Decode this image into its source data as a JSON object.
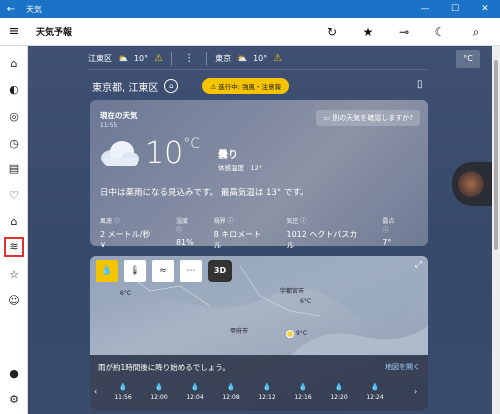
{
  "window": {
    "title": "天気"
  },
  "appbar": {
    "title": "天気予報"
  },
  "locations_strip": [
    {
      "name": "江東区",
      "temp": "10°"
    },
    {
      "name": "東京",
      "temp": "10°"
    }
  ],
  "unit_button": "°C",
  "location": {
    "name": "東京都, 江東区",
    "alert": "進行中: 強風・注意報"
  },
  "current": {
    "title": "現在の天気",
    "time": "11:55",
    "feedback": "別の天気を確認しますか?",
    "temp": "10",
    "unit": "°C",
    "condition": "曇り",
    "feels_like": "体感温度　12°",
    "summary": "日中は薬雨になる見込みです。 最高気温は 13° です。",
    "metrics": [
      {
        "label": "風速",
        "value": "2 メートル/秒 ∨"
      },
      {
        "label": "湿度",
        "value": "81%"
      },
      {
        "label": "視界",
        "value": "8 キロメートル"
      },
      {
        "label": "気圧",
        "value": "1012 ヘクトパスカル"
      },
      {
        "label": "露点",
        "value": "7°"
      }
    ]
  },
  "map": {
    "mode_3d": "3D",
    "labels": [
      "宇都宮市",
      "6°C",
      "甲府市",
      "9°C",
      "6°C"
    ],
    "rain_message": "雨が約1時間後に降り始めるでしょう。",
    "open_map": "地図を開く",
    "times": [
      "11:56",
      "12:00",
      "12:04",
      "12:08",
      "12:12",
      "12:16",
      "12:20",
      "12:24"
    ]
  },
  "icons": {
    "nav": [
      "home-icon",
      "forecast-icon",
      "news-icon",
      "history-icon",
      "calendar-icon",
      "maps-icon",
      "home-location-icon",
      "charts-icon",
      "favorites-icon",
      "feedback-icon",
      "account-icon",
      "settings-icon"
    ]
  }
}
